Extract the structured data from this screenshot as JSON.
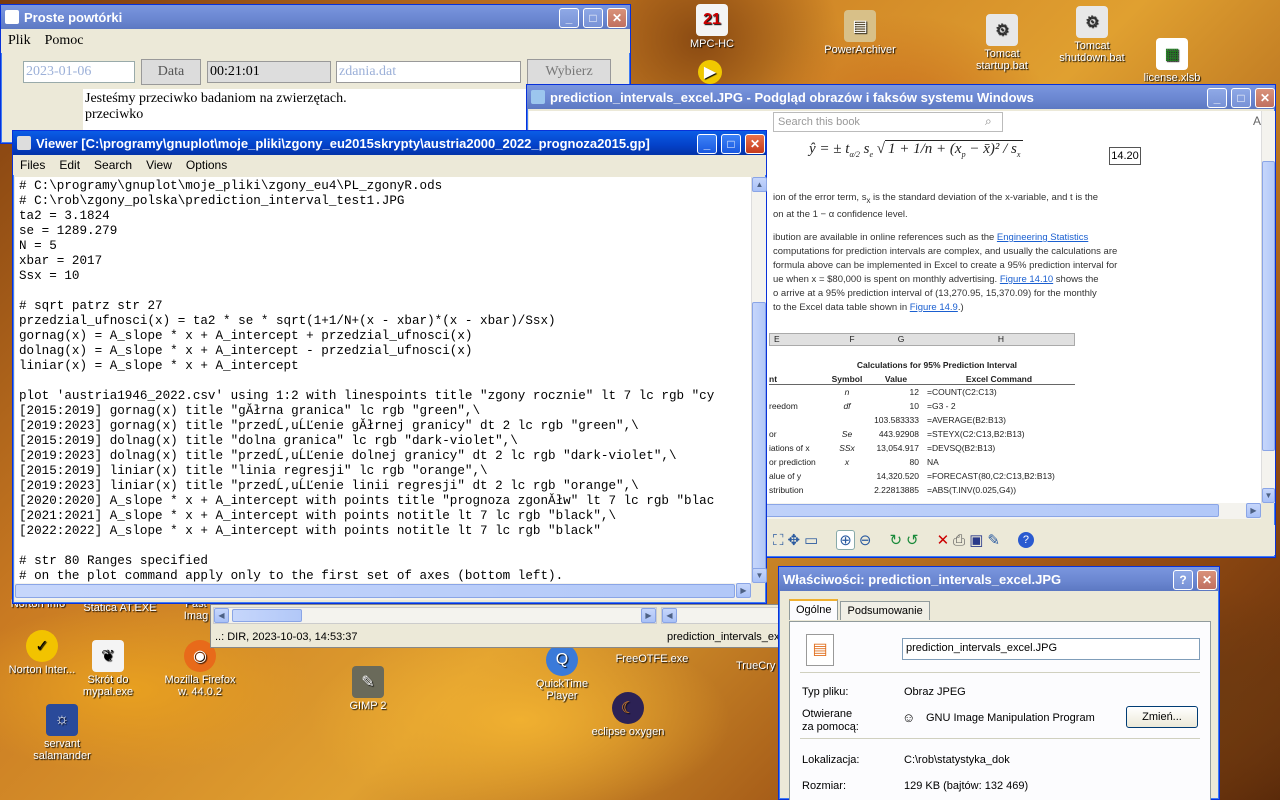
{
  "desktop_icons": {
    "mpc": "MPC-HC",
    "power": "PowerArchiver",
    "tomcat_start": "Tomcat startup.bat",
    "tomcat_shut": "Tomcat shutdown.bat",
    "license": "license.xlsb",
    "norton": "Norton Inter...",
    "skrot": "Skrót do mypal.exe",
    "firefox": "Mozilla Firefox w. 44.0.2",
    "gimp": "GIMP 2",
    "servant": "servant salamander",
    "quicktime": "QuickTime Player",
    "eclipse": "eclipse oxygen",
    "freeotfe": "FreeOTFE.exe",
    "truecrypt": "TrueCrypt",
    "statica": "Statica AT.EXE",
    "norton_info": "Norton Info",
    "fast": "Fast Imag"
  },
  "repeat_win": {
    "title": "Proste powtórki",
    "menu": [
      "Plik",
      "Pomoc"
    ],
    "date_value": "2023-01-06",
    "data_button": "Data",
    "time_value": "00:21:01",
    "file_value": "zdania.dat",
    "choose_button": "Wybierz",
    "sentence_1": "Jesteśmy przeciwko badaniom na zwierzętach.",
    "sentence_2": "przeciwko"
  },
  "viewer": {
    "title": "Viewer [C:\\programy\\gnuplot\\moje_pliki\\zgony_eu2015skrypty\\austria2000_2022_prognoza2015.gp]",
    "menu": [
      "Files",
      "Edit",
      "Search",
      "View",
      "Options"
    ],
    "lines": [
      "# C:\\programy\\gnuplot\\moje_pliki\\zgony_eu4\\PL_zgonyR.ods",
      "# C:\\rob\\zgony_polska\\prediction_interval_test1.JPG",
      "ta2 = 3.1824",
      "se = 1289.279",
      "N = 5",
      "xbar = 2017",
      "Ssx = 10",
      "",
      "# sqrt patrz str 27",
      "przedzial_ufnosci(x) = ta2 * se * sqrt(1+1/N+(x - xbar)*(x - xbar)/Ssx)",
      "gornag(x) = A_slope * x + A_intercept + przedzial_ufnosci(x)",
      "dolnag(x) = A_slope * x + A_intercept - przedzial_ufnosci(x)",
      "liniar(x) = A_slope * x + A_intercept",
      "",
      "plot 'austria1946_2022.csv' using 1:2 with linespoints title \"zgony rocznie\" lt 7 lc rgb \"cy",
      "[2015:2019] gornag(x) title \"gĂłrna granica\" lc rgb \"green\",\\",
      "[2019:2023] gornag(x) title \"przedĹ‚uĹĽenie gĂłrnej granicy\" dt 2 lc rgb \"green\",\\",
      "[2015:2019] dolnag(x) title \"dolna granica\" lc rgb \"dark-violet\",\\",
      "[2019:2023] dolnag(x) title \"przedĹ‚uĹĽenie dolnej granicy\" dt 2 lc rgb \"dark-violet\",\\",
      "[2015:2019] liniar(x) title \"linia regresji\" lc rgb \"orange\",\\",
      "[2019:2023] liniar(x) title \"przedĹ‚uĹĽenie linii regresji\" dt 2 lc rgb \"orange\",\\",
      "[2020:2020] A_slope * x + A_intercept with points title \"prognoza zgonĂłw\" lt 7 lc rgb \"blac",
      "[2021:2021] A_slope * x + A_intercept with points notitle lt 7 lc rgb \"black\",\\",
      "[2022:2022] A_slope * x + A_intercept with points notitle lt 7 lc rgb \"black\"",
      "",
      "# str 80 Ranges specified",
      "# on the plot command apply only to the first set of axes (bottom left)."
    ]
  },
  "image_viewer": {
    "title": "prediction_intervals_excel.JPG - Podgląd obrazów i faksów systemu Windows",
    "search_placeholder": "Search this book",
    "eq_number": "14.20",
    "para1": "ion of the error term, s",
    "para1b": "is the standard deviation of the x-variable, and t",
    "para1c": "is the",
    "para2": "on at the 1 − α confidence level.",
    "para3a": "ibution are available in online references such as the ",
    "para3link": "Engineering Statistics",
    "para3b": "computations for prediction intervals are complex, and usually the calculations are",
    "para3c": "formula above can be implemented in Excel to create a 95% prediction interval for",
    "para3d": "ue when x = $80,000 is spent on monthly advertising. ",
    "para3link2": "Figure 14.10",
    "para3e": " shows the",
    "para3f": "o arrive at a 95% prediction interval of (13,270.95, 15,370.09) for the monthly",
    "para3g": "to the Excel data table shown in ",
    "para3link3": "Figure 14.9",
    "para3h": ".)",
    "table_cols": [
      "E",
      "F",
      "G",
      "H"
    ],
    "table_title": "Calculations for 95% Prediction Interval",
    "table_head": [
      "nt",
      "Symbol",
      "Value",
      "Excel Command"
    ],
    "table_rows": [
      [
        "",
        "n",
        "12",
        "=COUNT(C2:C13)"
      ],
      [
        "reedom",
        "df",
        "10",
        "=G3 - 2"
      ],
      [
        "",
        "",
        "103.583333",
        "=AVERAGE(B2:B13)"
      ],
      [
        "or",
        "Se",
        "443.92908",
        "=STEYX(C2:C13,B2:B13)"
      ],
      [
        "iations of x",
        "SSx",
        "13,054.917",
        "=DEVSQ(B2:B13)"
      ],
      [
        "or prediction",
        "x",
        "80",
        "NA"
      ],
      [
        "alue of y",
        "",
        "14,320.520",
        "=FORECAST(80,C2:C13,B2:B13)"
      ],
      [
        "stribution",
        "",
        "2.22813885",
        "=ABS(T.INV(0.025,G4))"
      ]
    ]
  },
  "behind_panel": {
    "status_left": "..: DIR, 2023-10-03, 14:53:37",
    "status_right": "prediction_intervals_exc"
  },
  "properties": {
    "title": "Właściwości: prediction_intervals_excel.JPG",
    "tabs": [
      "Ogólne",
      "Podsumowanie"
    ],
    "filename": "prediction_intervals_excel.JPG",
    "type_label": "Typ pliku:",
    "type_value": "Obraz JPEG",
    "open_label_1": "Otwierane",
    "open_label_2": "za pomocą:",
    "open_value": "GNU Image Manipulation Program",
    "change_button": "Zmień...",
    "location_label": "Lokalizacja:",
    "location_value": "C:\\rob\\statystyka_dok",
    "size_label": "Rozmiar:",
    "size_value": "129 KB (bajtów: 132 469)"
  },
  "colors": {
    "xp_blue": "#0a5de6",
    "link": "#1a5fd0",
    "face": "#ece9d8"
  }
}
